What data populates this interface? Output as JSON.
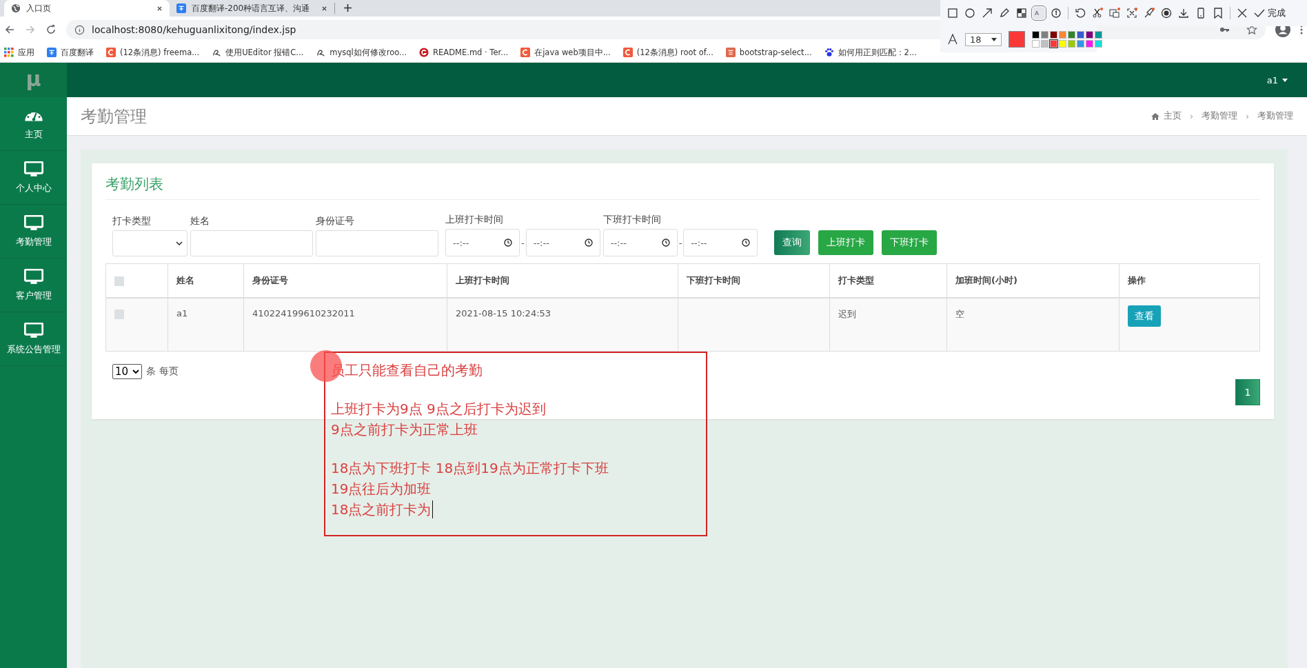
{
  "browser": {
    "tabs": [
      {
        "title": "入口页",
        "selected": true,
        "kind": "globe"
      },
      {
        "title": "百度翻译-200种语言互译、沟通",
        "selected": false,
        "kind": "translate"
      }
    ],
    "url": "localhost:8080/kehuguanlixitong/index.jsp",
    "apps_label": "应用",
    "bookmarks": [
      {
        "label": "百度翻译",
        "kind": "translate"
      },
      {
        "label": "(12条消息) freema...",
        "kind": "c"
      },
      {
        "label": "使用UEditor 报错C...",
        "kind": "swirl"
      },
      {
        "label": "mysql如何修改roo...",
        "kind": "swirl"
      },
      {
        "label": "README.md · Ter...",
        "kind": "g"
      },
      {
        "label": "在java web项目中...",
        "kind": "c"
      },
      {
        "label": "(12条消息) root of...",
        "kind": "c"
      },
      {
        "label": "bootstrap-select...",
        "kind": "jian"
      },
      {
        "label": "如何用正则匹配：2...",
        "kind": "paw"
      }
    ]
  },
  "capture_toolbar": {
    "done_label": "完成",
    "font_size": "18",
    "colors": [
      {
        "color": "#000000",
        "selected": false
      },
      {
        "color": "#808080",
        "selected": false
      },
      {
        "color": "#800000",
        "selected": false
      },
      {
        "color": "#f7883a",
        "selected": false
      },
      {
        "color": "#308430",
        "selected": false
      },
      {
        "color": "#385ad3",
        "selected": false
      },
      {
        "color": "#800080",
        "selected": false
      },
      {
        "color": "#009999",
        "selected": false
      },
      {
        "color": "#ffffff",
        "selected": false
      },
      {
        "color": "#c0c0c0",
        "selected": false
      },
      {
        "color": "#fb3838",
        "selected": true
      },
      {
        "color": "#ffff00",
        "selected": false
      },
      {
        "color": "#99cc00",
        "selected": false
      },
      {
        "color": "#3894e4",
        "selected": false
      },
      {
        "color": "#f31bf3",
        "selected": false
      },
      {
        "color": "#16dcdc",
        "selected": false
      }
    ]
  },
  "app": {
    "logo": "μ",
    "user": "a1",
    "sidebar": {
      "items": [
        {
          "label": "主页",
          "kind": "gauge"
        },
        {
          "label": "个人中心",
          "kind": "monitor"
        },
        {
          "label": "考勤管理",
          "kind": "monitor"
        },
        {
          "label": "客户管理",
          "kind": "monitor"
        },
        {
          "label": "系统公告管理",
          "kind": "monitor"
        }
      ]
    },
    "page_title": "考勤管理",
    "breadcrumb": [
      "主页",
      "考勤管理",
      "考勤管理"
    ],
    "breadcrumb_separator": "›",
    "card_title": "考勤列表",
    "filters": [
      {
        "label": "打卡类型",
        "kind": "select"
      },
      {
        "label": "姓名",
        "kind": "text"
      },
      {
        "label": "身份证号",
        "kind": "text"
      },
      {
        "label": "上班打卡时间",
        "kind": "timerange",
        "placeholder": "--:--",
        "separator": "-"
      },
      {
        "label": "下班打卡时间",
        "kind": "timerange",
        "placeholder": "--:--",
        "separator": "-"
      }
    ],
    "buttons": [
      {
        "label": "查询",
        "kind": "search"
      },
      {
        "label": "上班打卡",
        "kind": "action"
      },
      {
        "label": "下班打卡",
        "kind": "action"
      }
    ],
    "table": {
      "header_checked": false,
      "columns": [
        "姓名",
        "身份证号",
        "上班打卡时间",
        "下班打卡时间",
        "打卡类型",
        "加班时间(小时)",
        "操作"
      ],
      "rows": [
        {
          "checked": false,
          "cells": [
            "a1",
            "410224199610232011",
            "2021-08-15 10:24:53",
            "",
            "迟到",
            "空"
          ],
          "action": "查看"
        }
      ]
    },
    "page_size": "10",
    "page_size_suffix": "条 每页",
    "pages": [
      {
        "label": "1",
        "selected": true
      }
    ]
  },
  "annotation": {
    "paragraphs": [
      [
        "员工只能查看自己的考勤"
      ],
      [
        "上班打卡为9点  9点之后打卡为迟到",
        "9点之前打卡为正常上班"
      ],
      [
        "18点为下班打卡   18点到19点为正常打卡下班",
        "19点往后为加班",
        "18点之前打卡为"
      ]
    ]
  }
}
